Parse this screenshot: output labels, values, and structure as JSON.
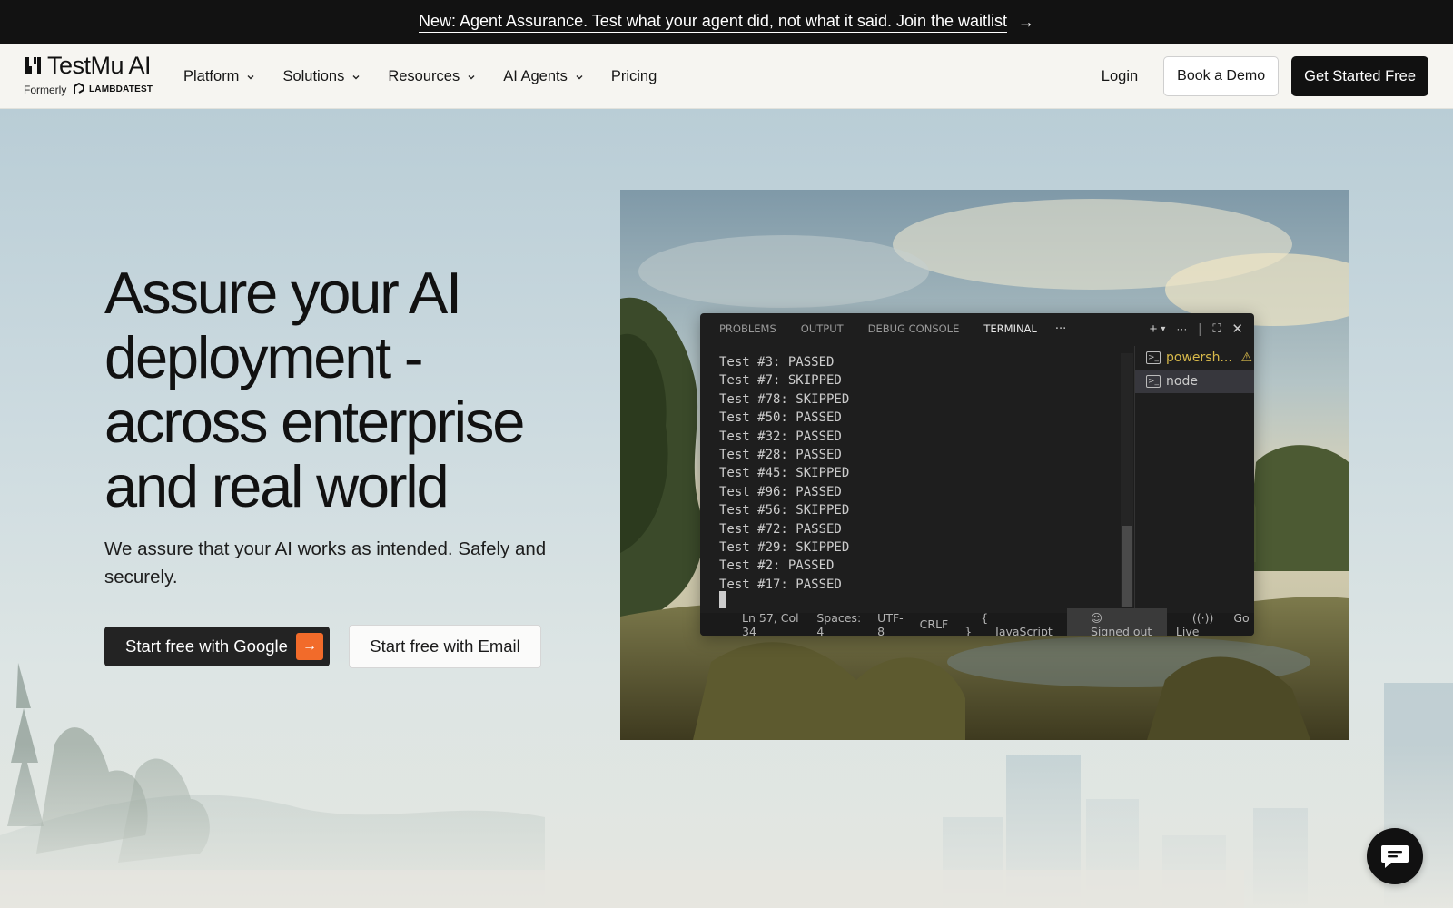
{
  "announcement": {
    "text": "New: Agent Assurance. Test what your agent did, not what it said. Join the waitlist",
    "arrow_icon": "arrow-right-icon"
  },
  "nav": {
    "brand": "TestMu AI",
    "formerly": "Formerly",
    "former_brand": "LAMBDATEST",
    "menu": [
      {
        "label": "Platform",
        "has_dropdown": true
      },
      {
        "label": "Solutions",
        "has_dropdown": true
      },
      {
        "label": "Resources",
        "has_dropdown": true
      },
      {
        "label": "AI Agents",
        "has_dropdown": true
      },
      {
        "label": "Pricing",
        "has_dropdown": false
      }
    ],
    "login": "Login",
    "book_demo": "Book a Demo",
    "get_started": "Get Started Free"
  },
  "hero": {
    "headline": "Assure your AI deployment - across enterprise and real world",
    "subtext": "We assure that your AI works as intended. Safely and securely.",
    "google_button": "Start free with Google",
    "email_button": "Start free with Email"
  },
  "vscode": {
    "tabs": [
      {
        "label": "PROBLEMS",
        "active": false
      },
      {
        "label": "OUTPUT",
        "active": false
      },
      {
        "label": "DEBUG CONSOLE",
        "active": false
      },
      {
        "label": "TERMINAL",
        "active": true
      }
    ],
    "more": "···",
    "terminal_lines": [
      "Test #3: PASSED",
      "Test #7: SKIPPED",
      "Test #78: SKIPPED",
      "Test #50: PASSED",
      "Test #32: PASSED",
      "Test #28: PASSED",
      "Test #45: SKIPPED",
      "Test #96: PASSED",
      "Test #56: SKIPPED",
      "Test #72: PASSED",
      "Test #29: SKIPPED",
      "Test #2: PASSED",
      "Test #17: PASSED"
    ],
    "terminals": [
      {
        "label": "powersh...",
        "warning": true,
        "selected": false
      },
      {
        "label": "node",
        "warning": false,
        "selected": true
      }
    ],
    "status": {
      "position": "Ln 57, Col 34",
      "spaces": "Spaces: 4",
      "encoding": "UTF-8",
      "eol": "CRLF",
      "language": "JavaScript",
      "language_icon": "{ }",
      "account": "Signed out",
      "golive": "Go Live"
    }
  },
  "colors": {
    "accent": "#f26b2a",
    "dark": "#111111",
    "terminal_bg": "#1e1e1e"
  }
}
